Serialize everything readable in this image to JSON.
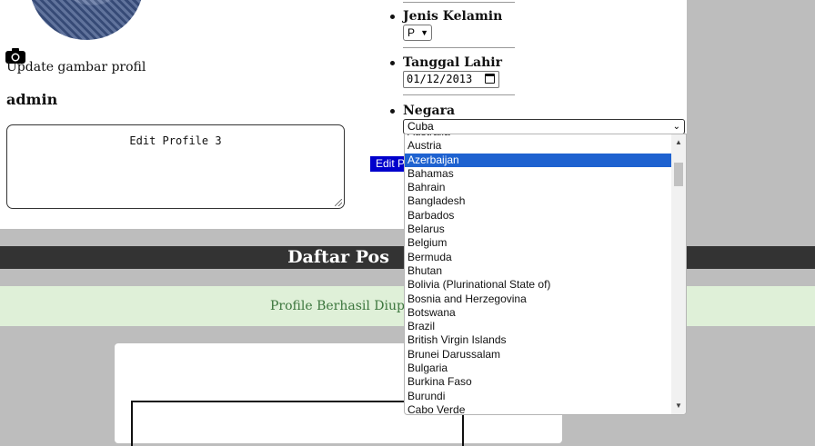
{
  "profile": {
    "update_picture_label": "Update gambar profil",
    "username": "admin",
    "bio_value": "Edit Profile 3"
  },
  "fields": {
    "gender_label": "Jenis Kelamin",
    "gender_value": "P",
    "birthdate_label": "Tanggal Lahir",
    "birthdate_value": "01/12/2013",
    "country_label": "Negara",
    "country_value": "Cuba"
  },
  "edit_button_label": "Edit Profile",
  "section_title": "Daftar Pos",
  "alert_text": "Profile Berhasil Diupdate",
  "country_options": [
    "Australia",
    "Austria",
    "Azerbaijan",
    "Bahamas",
    "Bahrain",
    "Bangladesh",
    "Barbados",
    "Belarus",
    "Belgium",
    "Bermuda",
    "Bhutan",
    "Bolivia (Plurinational State of)",
    "Bosnia and Herzegovina",
    "Botswana",
    "Brazil",
    "British Virgin Islands",
    "Brunei Darussalam",
    "Bulgaria",
    "Burkina Faso",
    "Burundi",
    "Cabo Verde"
  ],
  "highlighted_country": "Azerbaijan"
}
